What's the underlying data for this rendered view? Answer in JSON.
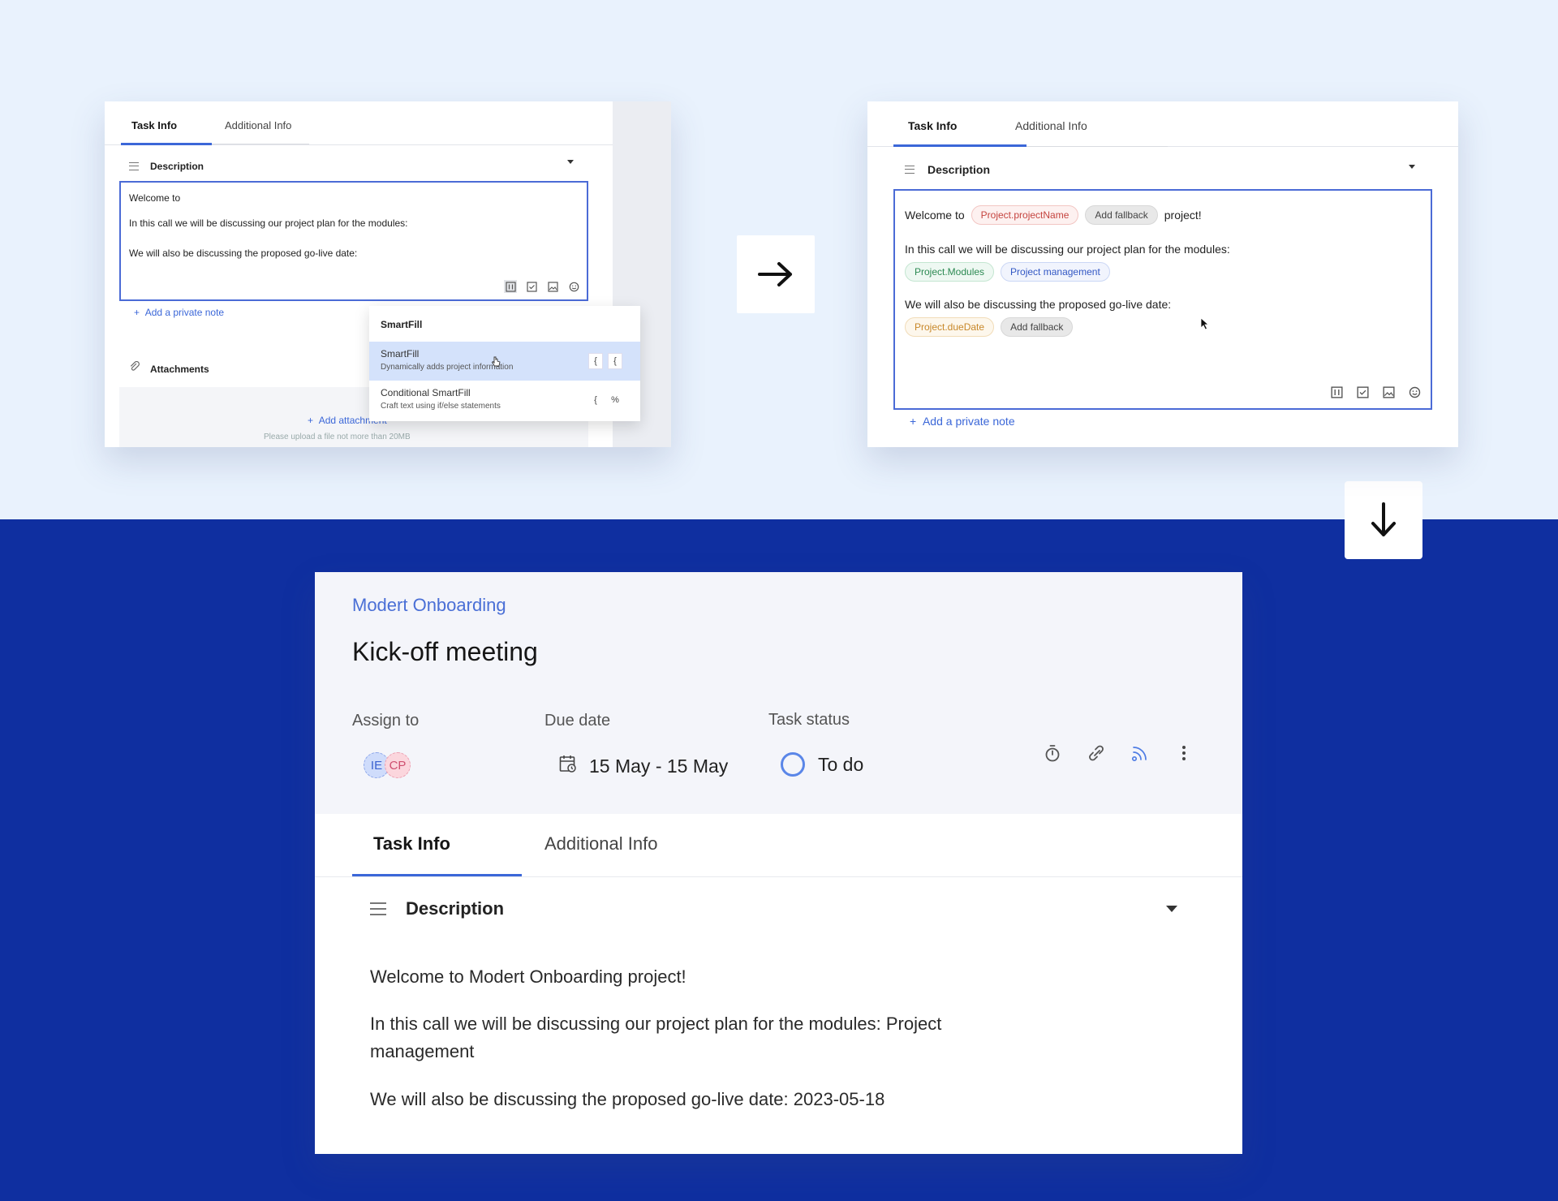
{
  "card1": {
    "tabs": [
      "Task Info",
      "Additional Info"
    ],
    "description_label": "Description",
    "editor_lines": [
      "Welcome to",
      "In this call we will be discussing our project plan for the modules:",
      "We will also be discussing the proposed go-live date:"
    ],
    "toolbar_icons": [
      "smartfill-icon",
      "checklist-icon",
      "image-icon",
      "emoji-icon"
    ],
    "add_private_note": "Add a private note",
    "attachments_label": "Attachments",
    "add_attachment": "Add attachment",
    "upload_hint": "Please upload a file not more than 20MB",
    "dropdown": {
      "header": "SmartFill",
      "items": [
        {
          "title": "SmartFill",
          "subtitle": "Dynamically adds project information",
          "keys": [
            "{",
            "{"
          ]
        },
        {
          "title": "Conditional SmartFill",
          "subtitle": "Craft text using if/else statements",
          "keys": [
            "{",
            "%"
          ]
        }
      ]
    }
  },
  "card2": {
    "tabs": [
      "Task Info",
      "Additional Info"
    ],
    "description_label": "Description",
    "line1": {
      "prefix": "Welcome to",
      "chip_var": "Project.projectName",
      "chip_fallback": "Add fallback",
      "suffix": "project!"
    },
    "line2": {
      "text": "In this call we will be discussing our project plan for the modules:",
      "chip_var": "Project.Modules",
      "chip_value": "Project management"
    },
    "line3": {
      "text": "We will also be discussing the proposed go-live date:",
      "chip_var": "Project.dueDate",
      "chip_fallback": "Add fallback"
    },
    "add_private_note": "Add a private note"
  },
  "card3": {
    "breadcrumb": "Modert Onboarding",
    "title": "Kick-off meeting",
    "assign_label": "Assign to",
    "due_label": "Due date",
    "status_label": "Task status",
    "assignees": [
      "IE",
      "CP"
    ],
    "due_range": "15 May - 15 May",
    "status_value": "To do",
    "tabs": [
      "Task Info",
      "Additional Info"
    ],
    "description_label": "Description",
    "body": [
      "Welcome to  Modert Onboarding project!",
      "In this call we will be discussing our project plan for the modules:   Project management",
      "We will also be discussing the proposed go-live date:  2023-05-18"
    ]
  },
  "colors": {
    "top_background": "#e9f2fd",
    "bottom_background": "#0f2fa0",
    "accent": "#3b67d8"
  }
}
